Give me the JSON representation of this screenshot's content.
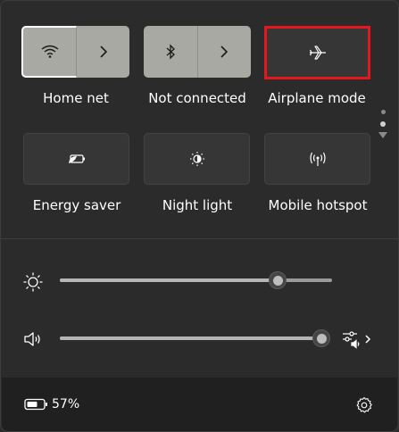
{
  "tiles": [
    {
      "label": "Home net"
    },
    {
      "label": "Not connected"
    },
    {
      "label": "Airplane mode"
    },
    {
      "label": "Energy saver"
    },
    {
      "label": "Night light"
    },
    {
      "label": "Mobile hotspot"
    }
  ],
  "brightness": {
    "level": 0.8
  },
  "volume": {
    "level": 1.0
  },
  "battery": {
    "percent": "57%"
  },
  "colors": {
    "highlight": "#e6161f",
    "active_tile": "#a9a9a4",
    "background": "#2b2b2b"
  }
}
